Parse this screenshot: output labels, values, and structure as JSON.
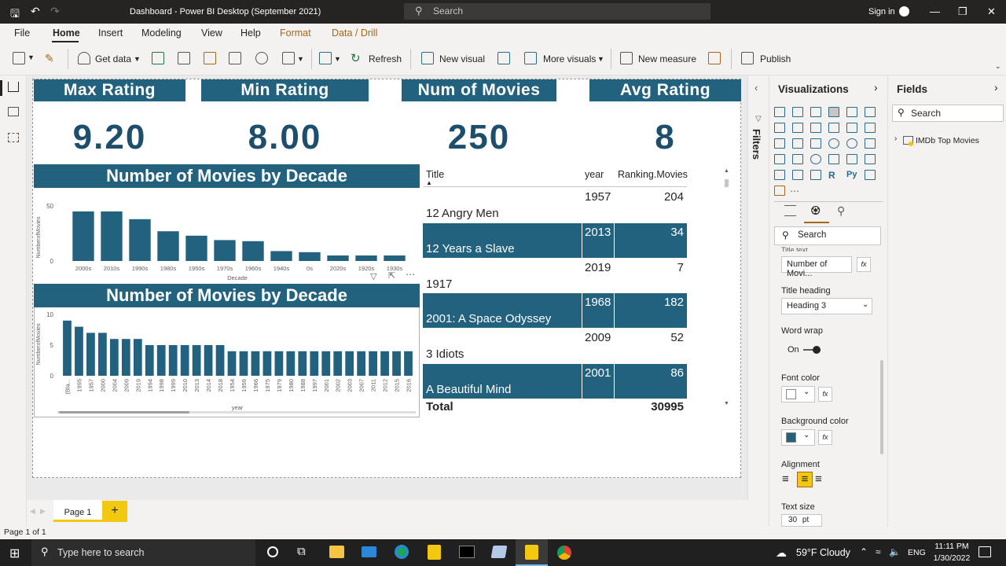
{
  "titlebar": {
    "title": "Dashboard - Power BI Desktop (September 2021)",
    "search_placeholder": "Search",
    "signin": "Sign in"
  },
  "menu": [
    "File",
    "Home",
    "Insert",
    "Modeling",
    "View",
    "Help",
    "Format",
    "Data / Drill"
  ],
  "ribbon": {
    "get_data": "Get data",
    "refresh": "Refresh",
    "new_visual": "New visual",
    "more_visuals": "More visuals",
    "new_measure": "New measure",
    "publish": "Publish"
  },
  "cards": [
    {
      "title": "Max Rating",
      "value": "9.20"
    },
    {
      "title": "Min Rating",
      "value": "8.00"
    },
    {
      "title": "Num of Movies",
      "value": "250"
    },
    {
      "title": "Avg Rating",
      "value": "8"
    }
  ],
  "chart1": {
    "title": "Number of Movies by Decade",
    "ylabel": "NumberofMovies",
    "xlabel": "Decade",
    "yticks": [
      "50",
      "0"
    ],
    "categories": [
      "2000s",
      "2010s",
      "1990s",
      "1980s",
      "1950s",
      "1970s",
      "1960s",
      "1940s",
      "0s",
      "2020s",
      "1920s",
      "1930s"
    ],
    "values": [
      45,
      45,
      38,
      27,
      23,
      19,
      18,
      9,
      8,
      5,
      5,
      5
    ]
  },
  "chart2": {
    "title": "Number of Movies by Decade",
    "ylabel": "NumberofMovies",
    "xlabel": "year",
    "yticks": [
      "10",
      "5",
      "0"
    ],
    "categories": [
      "(Bla...",
      "1995",
      "1957",
      "2000",
      "2004",
      "2009",
      "2019",
      "1994",
      "1998",
      "1999",
      "2010",
      "2013",
      "2014",
      "2018",
      "1954",
      "1959",
      "1966",
      "1975",
      "1979",
      "1980",
      "1988",
      "1997",
      "2001",
      "2002",
      "2003",
      "2007",
      "2011",
      "2012",
      "2015",
      "2016"
    ],
    "values": [
      9,
      8,
      7,
      7,
      6,
      6,
      6,
      5,
      5,
      5,
      5,
      5,
      5,
      5,
      4,
      4,
      4,
      4,
      4,
      4,
      4,
      4,
      4,
      4,
      4,
      4,
      4,
      4,
      4,
      4
    ]
  },
  "table": {
    "headers": [
      "Title",
      "year",
      "Ranking.Movies"
    ],
    "rows": [
      {
        "title": "12 Angry Men",
        "year": "1957",
        "rank": "204"
      },
      {
        "title": "12 Years a Slave",
        "year": "2013",
        "rank": "34"
      },
      {
        "title": "1917",
        "year": "2019",
        "rank": "7"
      },
      {
        "title": "2001: A Space Odyssey",
        "year": "1968",
        "rank": "182"
      },
      {
        "title": "3 Idiots",
        "year": "2009",
        "rank": "52"
      },
      {
        "title": "A Beautiful Mind",
        "year": "2001",
        "rank": "86"
      }
    ],
    "total_label": "Total",
    "total_value": "30995"
  },
  "filters_label": "Filters",
  "visualizations": {
    "title": "Visualizations",
    "search_placeholder": "Search",
    "title_text_label": "Title text",
    "title_text_value": "Number of Movi...",
    "title_heading_label": "Title heading",
    "title_heading_value": "Heading 3",
    "word_wrap_label": "Word wrap",
    "word_wrap_state": "On",
    "font_color_label": "Font color",
    "bg_color_label": "Background color",
    "alignment_label": "Alignment",
    "text_size_label": "Text size",
    "text_size_value": "30",
    "text_size_unit": "pt",
    "fx": "fx",
    "bg_color": "#23627f"
  },
  "fields": {
    "title": "Fields",
    "search_placeholder": "Search",
    "table_name": "IMDb Top Movies"
  },
  "pages": {
    "tab": "Page 1",
    "add": "+"
  },
  "status": "Page 1 of 1",
  "taskbar": {
    "search_placeholder": "Type here to search",
    "weather": "59°F Cloudy",
    "lang": "ENG",
    "time": "11:11 PM",
    "date": "1/30/2022"
  },
  "colors": {
    "accent": "#23627f",
    "card_value": "#1d4e6b",
    "format_tab": "#a6661a"
  }
}
